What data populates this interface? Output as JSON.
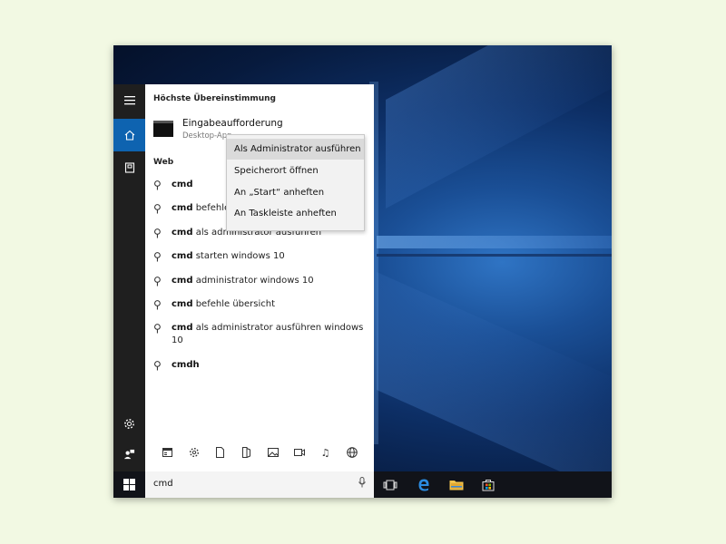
{
  "best_match": {
    "header": "Höchste Übereinstimmung",
    "app_name": "Eingabeaufforderung",
    "app_subtitle": "Desktop-App"
  },
  "web": {
    "header": "Web",
    "items": [
      {
        "bold": "cmd",
        "rest": ""
      },
      {
        "bold": "cmd",
        "rest": " befehle"
      },
      {
        "bold": "cmd",
        "rest": " als administrator ausführen"
      },
      {
        "bold": "cmd",
        "rest": " starten windows 10"
      },
      {
        "bold": "cmd",
        "rest": " administrator windows 10"
      },
      {
        "bold": "cmd",
        "rest": " befehle übersicht"
      },
      {
        "bold": "cmd",
        "rest": " als administrator ausführen windows 10"
      },
      {
        "bold": "cmdh",
        "rest": ""
      }
    ]
  },
  "context_menu": {
    "items": [
      "Als Administrator ausführen",
      "Speicherort öffnen",
      "An „Start“ anheften",
      "An Taskleiste anheften"
    ]
  },
  "search": {
    "value": "cmd"
  },
  "colors": {
    "accent": "#0e63b0",
    "rail": "#1f1f1f",
    "taskbar": "#111319"
  },
  "icons": {
    "rail": [
      "hamburger-icon",
      "home-icon",
      "notebook-icon",
      "settings-icon",
      "feedback-icon"
    ],
    "categories": [
      "apps-icon",
      "settings-icon",
      "document-icon",
      "folder-icon",
      "photo-icon",
      "video-icon",
      "music-icon",
      "web-icon"
    ],
    "taskbar": [
      "windows-icon",
      "task-view-icon",
      "edge-icon",
      "file-explorer-icon",
      "store-icon"
    ]
  }
}
